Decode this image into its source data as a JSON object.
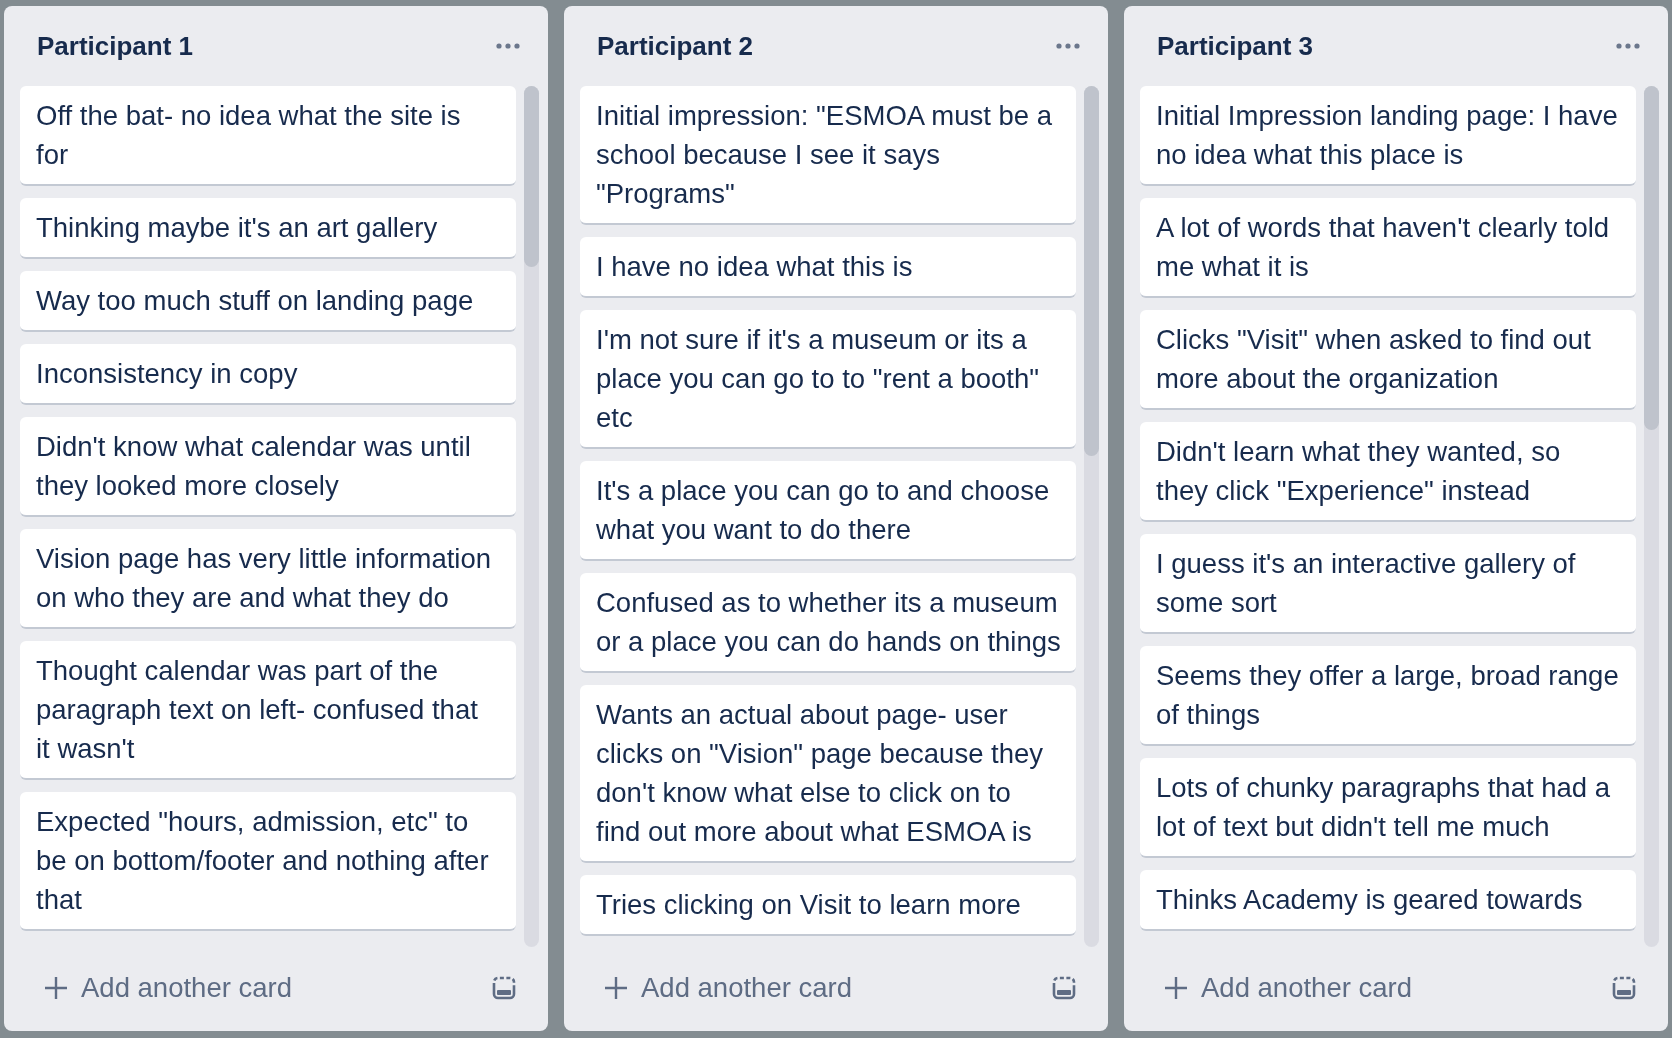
{
  "lists": [
    {
      "title": "Participant 1",
      "cards": [
        {
          "lines": [
            "Off the bat- no idea what the site is",
            "for"
          ]
        },
        {
          "lines": [
            "Thinking maybe it's an art gallery"
          ]
        },
        {
          "lines": [
            "Way too much stuff on landing page"
          ]
        },
        {
          "lines": [
            "Inconsistency in copy"
          ]
        },
        {
          "lines": [
            "Didn't know what calendar was until",
            "they looked more closely"
          ]
        },
        {
          "lines": [
            "Vision page has very little information",
            "on who they are and what they do"
          ]
        },
        {
          "lines": [
            "Thought calendar was part of the",
            "paragraph text on left- confused that",
            "it wasn't"
          ]
        },
        {
          "lines": [
            "Expected \"hours, admission, etc\" to",
            "be on bottom/footer and nothing after",
            "that"
          ]
        }
      ],
      "add_card": "Add another card"
    },
    {
      "title": "Participant 2",
      "cards": [
        {
          "lines": [
            "Initial impression: \"ESMOA must be a",
            "school because I see it says",
            "\"Programs\""
          ]
        },
        {
          "lines": [
            "I have no idea what this is"
          ]
        },
        {
          "lines": [
            "I'm not sure if it's a museum or its a",
            "place you can go to to \"rent a booth\"",
            "etc"
          ]
        },
        {
          "lines": [
            "It's a place you can go to and choose",
            "what you want to do there"
          ]
        },
        {
          "lines": [
            "Confused as to whether its a museum",
            "or a place you can do hands on things"
          ]
        },
        {
          "lines": [
            "Wants an actual about page- user",
            "clicks on \"Vision\" page because they",
            "don't know what else to click on to",
            "find out more about what ESMOA is"
          ]
        },
        {
          "lines": [
            "Tries clicking on Visit to learn more"
          ]
        }
      ],
      "add_card": "Add another card"
    },
    {
      "title": "Participant 3",
      "cards": [
        {
          "lines": [
            "Initial Impression landing page: I have",
            "no idea what this place is"
          ]
        },
        {
          "lines": [
            "A lot of words that haven't clearly told",
            "me what it is"
          ]
        },
        {
          "lines": [
            "Clicks \"Visit\" when asked to find out",
            "more about the organization"
          ]
        },
        {
          "lines": [
            "Didn't learn what they wanted, so",
            "they click \"Experience\" instead"
          ]
        },
        {
          "lines": [
            "I guess it's an interactive gallery of",
            "some sort"
          ]
        },
        {
          "lines": [
            "Seems they offer a large, broad range",
            "of things"
          ]
        },
        {
          "lines": [
            "Lots of chunky paragraphs that had a",
            "lot of text but didn't tell me much"
          ]
        },
        {
          "lines": [
            "Thinks Academy is geared towards"
          ]
        }
      ],
      "add_card": "Add another card"
    }
  ]
}
